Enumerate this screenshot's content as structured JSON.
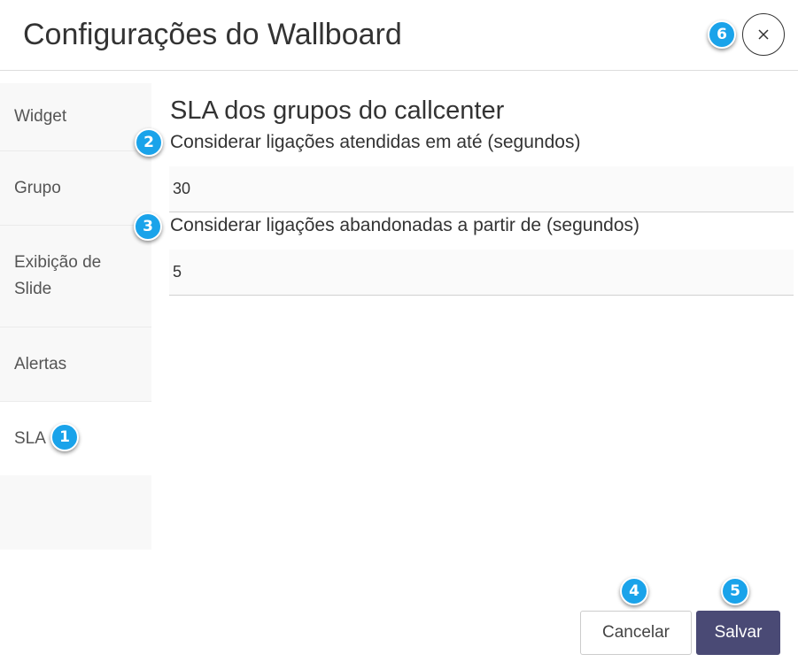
{
  "dialog": {
    "title": "Configurações do Wallboard",
    "close_label": "×"
  },
  "sidebar": {
    "items": [
      {
        "label": "Widget"
      },
      {
        "label": "Grupo"
      },
      {
        "label": "Exibição de Slide"
      },
      {
        "label": "Alertas"
      },
      {
        "label": "SLA",
        "active": true
      }
    ]
  },
  "main": {
    "section_title": "SLA dos grupos do callcenter",
    "fields": [
      {
        "label": "Considerar ligações atendidas em até (segundos)",
        "value": "30"
      },
      {
        "label": "Considerar ligações abandonadas a partir de (segundos)",
        "value": "5"
      }
    ]
  },
  "footer": {
    "cancel_label": "Cancelar",
    "save_label": "Salvar"
  },
  "badges": [
    "1",
    "2",
    "3",
    "4",
    "5",
    "6"
  ],
  "colors": {
    "badge": "#1aa3ea",
    "primary_button": "#4a4a75",
    "sidebar_bg": "#f8f8f8"
  }
}
